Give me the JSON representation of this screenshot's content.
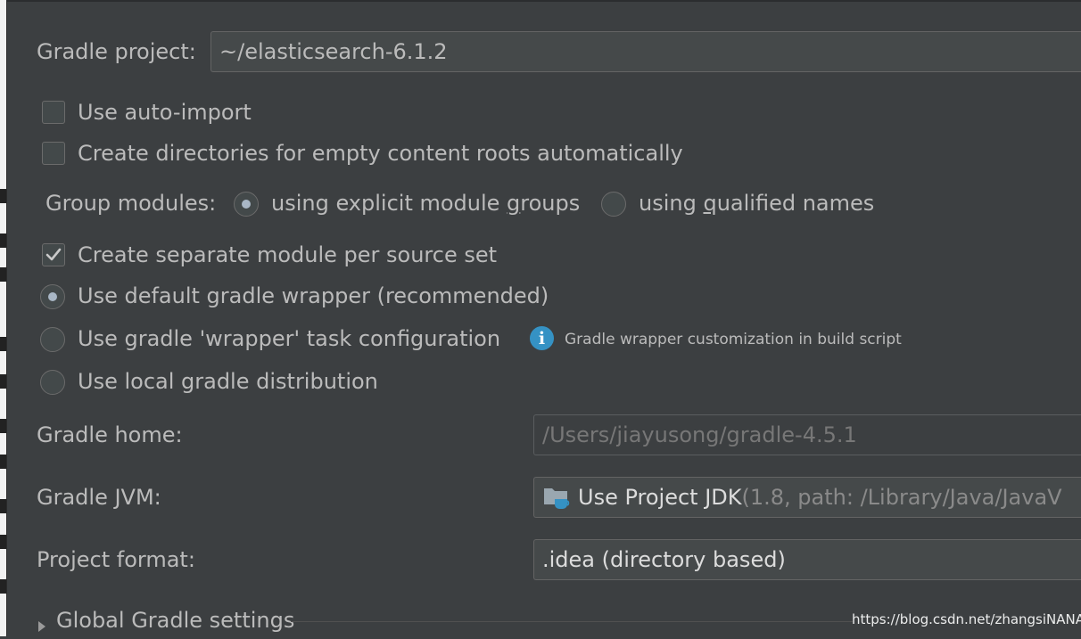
{
  "gradle_project": {
    "label": "Gradle project:",
    "value": "~/elasticsearch-6.1.2"
  },
  "options": {
    "auto_import": {
      "label": "Use auto-import",
      "checked": false
    },
    "create_dirs": {
      "label": "Create directories for empty content roots automatically",
      "checked": false
    },
    "separate_module": {
      "label": "Create separate module per source set",
      "checked": true
    }
  },
  "group_modules": {
    "label": "Group modules:",
    "explicit": {
      "label_pre": "using explicit module ",
      "mnemonic": "g",
      "label_post": "roups",
      "selected": true
    },
    "qualified": {
      "label_pre": "using ",
      "mnemonic": "q",
      "label_post": "ualified names",
      "selected": false
    }
  },
  "wrapper": {
    "default": {
      "label": "Use default gradle wrapper (recommended)",
      "selected": true
    },
    "task": {
      "label": "Use gradle 'wrapper' task configuration",
      "selected": false
    },
    "local": {
      "label": "Use local gradle distribution",
      "selected": false
    },
    "info_icon": "info-icon",
    "info_hint": "Gradle wrapper customization in build script"
  },
  "gradle_home": {
    "label": "Gradle home:",
    "value": "/Users/jiayusong/gradle-4.5.1"
  },
  "gradle_jvm": {
    "label": "Gradle JVM:",
    "icon": "jdk-folder-icon",
    "value_main": "Use Project JDK",
    "value_detail": " (1.8, path: /Library/Java/JavaV"
  },
  "project_format": {
    "label": "Project format:",
    "value": ".idea (directory based)"
  },
  "global_settings": {
    "label": "Global Gradle settings",
    "expanded": false
  },
  "watermark": "https://blog.csdn.net/zhangsiNANA",
  "colors": {
    "background": "#3c3f41",
    "text": "#bbbbbb",
    "info_blue": "#3592c4",
    "field_bg": "#45494a"
  }
}
